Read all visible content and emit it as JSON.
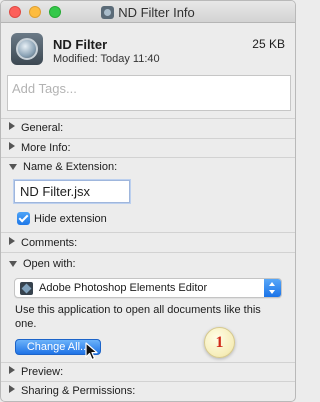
{
  "window": {
    "title": "ND Filter Info",
    "title_icon": "jsx-file-icon"
  },
  "header": {
    "name": "ND Filter",
    "size": "25 KB",
    "modified": "Modified:  Today 11:40",
    "icon": "jsx-file-icon"
  },
  "tags": {
    "placeholder": "Add Tags..."
  },
  "sections": {
    "general": "General:",
    "more_info": "More Info:",
    "name_extension": "Name & Extension:",
    "comments": "Comments:",
    "open_with": "Open with:",
    "preview": "Preview:",
    "sharing": "Sharing & Permissions:"
  },
  "name_extension": {
    "filename": "ND Filter.jsx",
    "hide_extension_label": "Hide extension",
    "hide_extension_checked": true
  },
  "open_with": {
    "selected_app": "Adobe Photoshop Elements Editor",
    "app_icon": "photoshop-elements-icon",
    "help_text": "Use this application to open all documents like this one.",
    "change_all_label": "Change All..."
  },
  "annotation": {
    "badge_number": "1"
  },
  "colors": {
    "accent": "#1f73e6",
    "badge_text": "#d12a1a",
    "badge_fill": "#f6edb9"
  }
}
